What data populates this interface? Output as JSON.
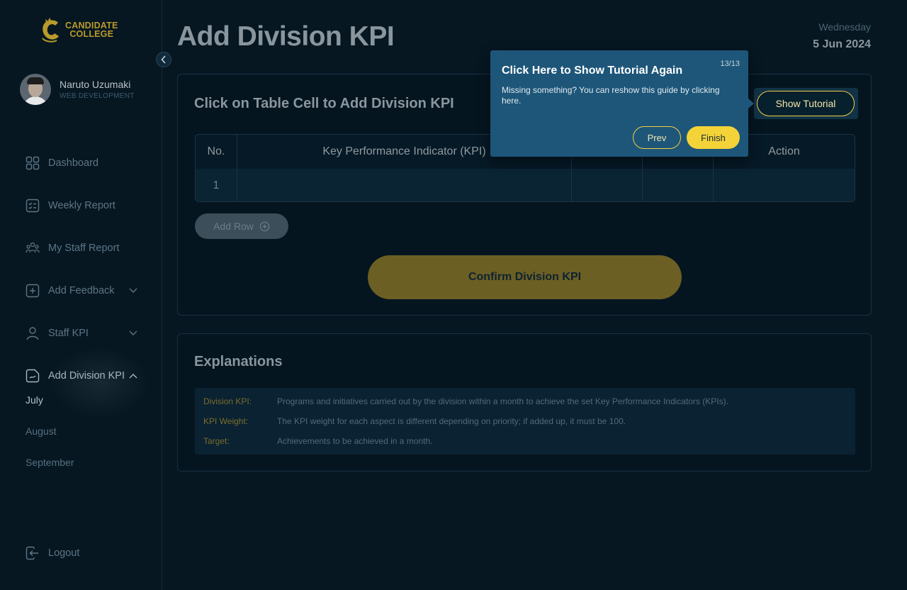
{
  "app": {
    "logo_line1": "CANDIDATE",
    "logo_line2": "COLLEGE"
  },
  "profile": {
    "name": "Naruto Uzumaki",
    "role": "WEB DEVELOPMENT"
  },
  "sidebar": {
    "items": [
      {
        "label": "Dashboard",
        "icon": "grid-icon"
      },
      {
        "label": "Weekly Report",
        "icon": "report-icon"
      },
      {
        "label": "My Staff Report",
        "icon": "users-icon"
      },
      {
        "label": "Add Feedback",
        "icon": "plus-square-icon"
      },
      {
        "label": "Staff KPI",
        "icon": "user-icon"
      },
      {
        "label": "Add Division KPI",
        "icon": "chart-doc-icon"
      }
    ],
    "submenu": [
      "July",
      "August",
      "September"
    ],
    "logout": "Logout"
  },
  "header": {
    "title": "Add Division KPI",
    "day": "Wednesday",
    "date": "5 Jun 2024"
  },
  "kpi_card": {
    "title": "Click on Table Cell to Add Division KPI",
    "show_tutorial": "Show Tutorial",
    "columns": [
      "No.",
      "Key Performance Indicator (KPI)",
      "",
      "",
      "Action"
    ],
    "rows": [
      [
        "1",
        "",
        "",
        "",
        ""
      ]
    ],
    "add_row": "Add Row",
    "confirm": "Confirm Division KPI"
  },
  "explanations": {
    "title": "Explanations",
    "items": [
      {
        "term": "Division KPI:",
        "def": "Programs and initiatives carried out by the division within a month to achieve the set Key Performance Indicators (KPIs)."
      },
      {
        "term": "KPI Weight:",
        "def": "The KPI weight for each aspect is different depending on priority; if added up, it must be 100."
      },
      {
        "term": "Target:",
        "def": "Achievements to be achieved in a month."
      }
    ]
  },
  "tooltip": {
    "step": "13/13",
    "title": "Click Here to Show Tutorial Again",
    "description": "Missing something? You can reshow this guide by clicking here.",
    "prev": "Prev",
    "finish": "Finish"
  },
  "colors": {
    "accent": "#f4d339",
    "background": "#061722",
    "tooltip": "#1d5679"
  }
}
